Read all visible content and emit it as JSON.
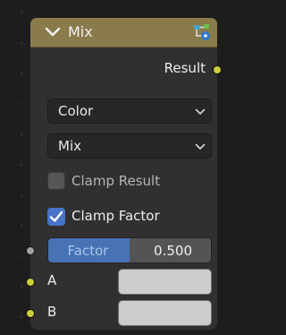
{
  "node": {
    "title": "Mix",
    "header_color": "#8a7b4a",
    "collapse_icon": "chevron-down-icon",
    "type_icon": "node-group-icon",
    "output": {
      "label": "Result",
      "socket_color": "#cccf3a"
    },
    "data_type_dropdown": {
      "value": "Color"
    },
    "blend_mode_dropdown": {
      "value": "Mix"
    },
    "clamp_result": {
      "label": "Clamp Result",
      "checked": false
    },
    "clamp_factor": {
      "label": "Clamp Factor",
      "checked": true
    },
    "factor": {
      "label": "Factor",
      "value": "0.500",
      "fraction": 0.5
    },
    "inputs": [
      {
        "label": "A",
        "swatch_color": "#cdcdcd"
      },
      {
        "label": "B",
        "swatch_color": "#cdcdcd"
      }
    ],
    "accent_color": "#4772b3"
  }
}
